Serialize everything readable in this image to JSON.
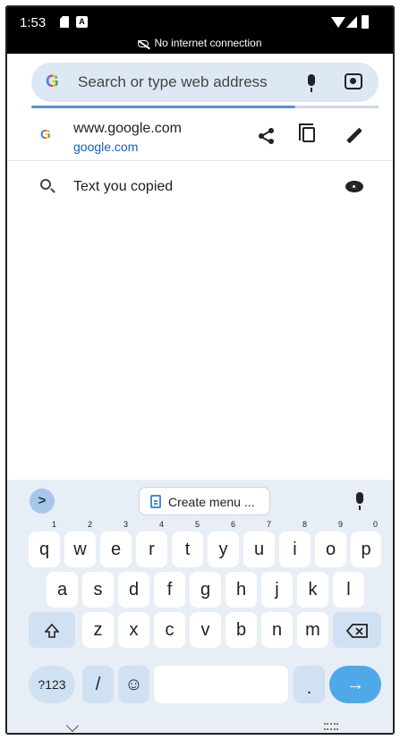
{
  "status_bar": {
    "time": "1:53",
    "connection_text": "No internet connection"
  },
  "address_bar": {
    "placeholder": "Search or type web address",
    "load_progress": 0.76
  },
  "suggestions": [
    {
      "title": "www.google.com",
      "url": "google.com"
    },
    {
      "title": "Text you copied"
    }
  ],
  "keyboard": {
    "suggestion_chip": "Create menu ...",
    "row1": [
      "q",
      "w",
      "e",
      "r",
      "t",
      "y",
      "u",
      "i",
      "o",
      "p"
    ],
    "row1_hints": [
      "1",
      "2",
      "3",
      "4",
      "5",
      "6",
      "7",
      "8",
      "9",
      "0"
    ],
    "row2": [
      "a",
      "s",
      "d",
      "f",
      "g",
      "h",
      "j",
      "k",
      "l"
    ],
    "row3": [
      "z",
      "x",
      "c",
      "v",
      "b",
      "n",
      "m"
    ],
    "symbols_key": "?123",
    "slash_key": "/",
    "period_key": ".",
    "emoji_key": "☺",
    "enter_key": "→",
    "expand_key": ">"
  },
  "colors": {
    "accent": "#4fa8e8",
    "address_bg": "#dde8f4",
    "link": "#1a5fb4",
    "keyboard_bg": "#e8eef5"
  }
}
